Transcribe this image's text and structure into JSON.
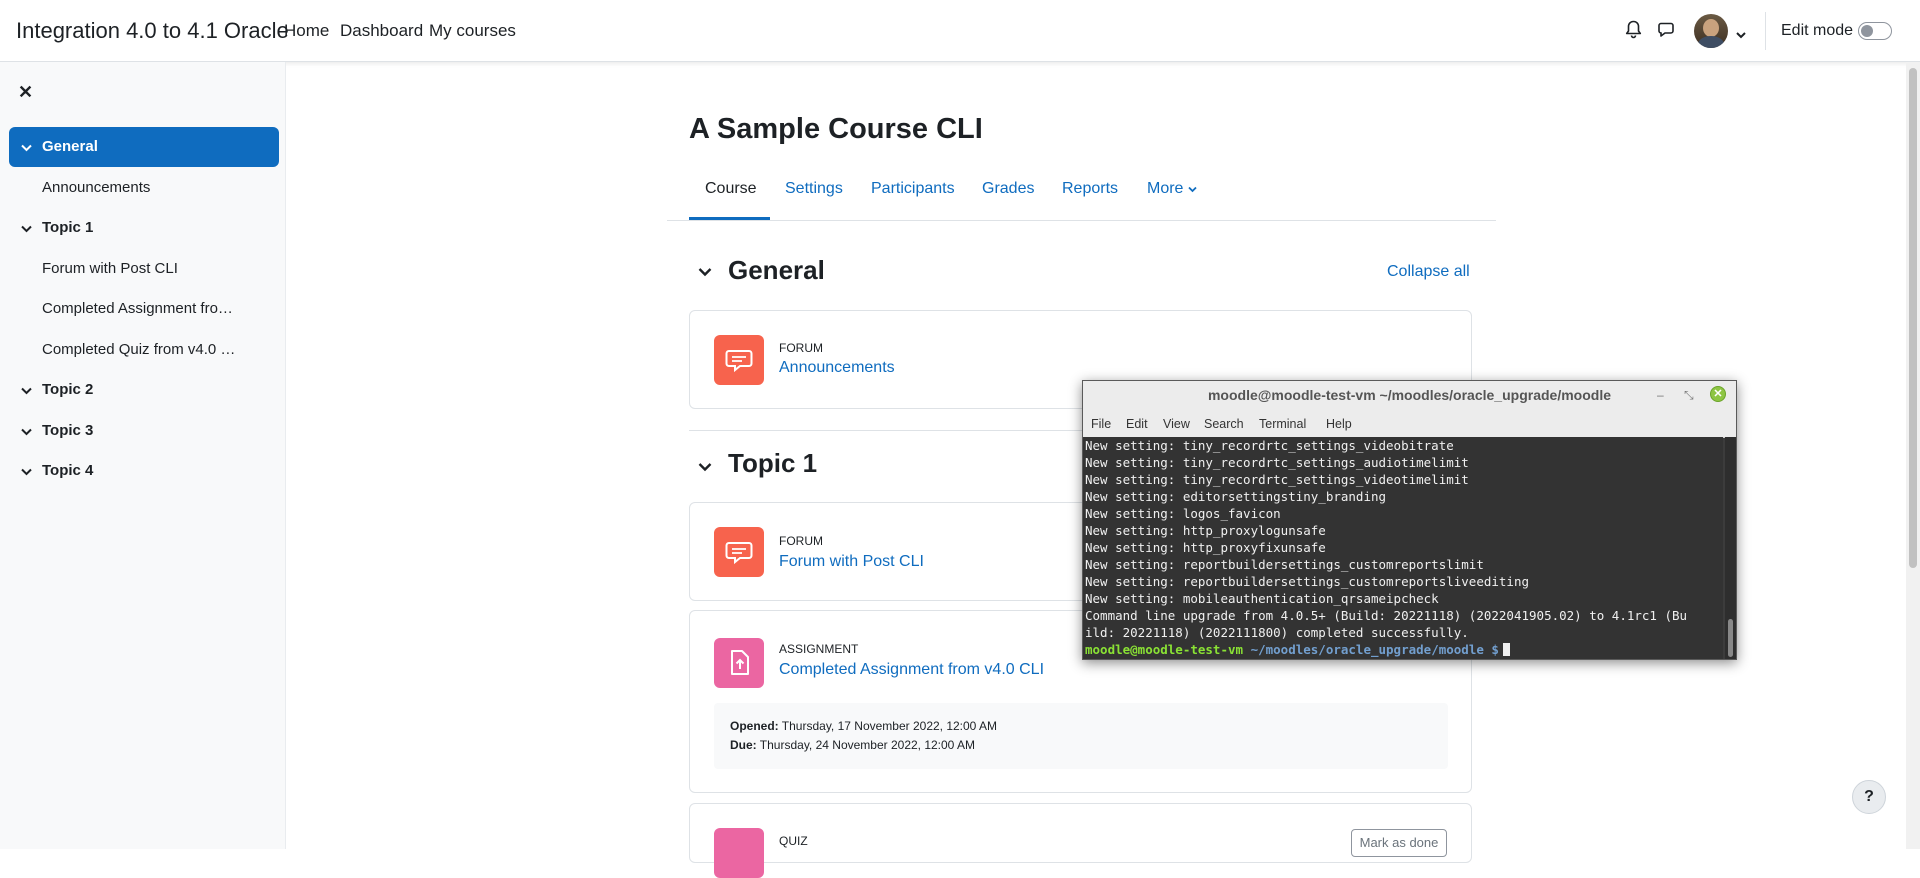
{
  "navbar": {
    "site_name": "Integration 4.0 to 4.1 Oracle",
    "links": [
      "Home",
      "Dashboard",
      "My courses"
    ],
    "edit_mode_label": "Edit mode"
  },
  "drawer": {
    "items": [
      {
        "label": "General",
        "type": "section",
        "active": true
      },
      {
        "label": "Announcements",
        "type": "child"
      },
      {
        "label": "Topic 1",
        "type": "section"
      },
      {
        "label": "Forum with Post CLI",
        "type": "child"
      },
      {
        "label": "Completed Assignment fro…",
        "type": "child"
      },
      {
        "label": "Completed Quiz from v4.0 …",
        "type": "child"
      },
      {
        "label": "Topic 2",
        "type": "section"
      },
      {
        "label": "Topic 3",
        "type": "section"
      },
      {
        "label": "Topic 4",
        "type": "section"
      }
    ]
  },
  "course": {
    "title": "A Sample Course CLI",
    "tabs": [
      "Course",
      "Settings",
      "Participants",
      "Grades",
      "Reports",
      "More"
    ],
    "collapse_all": "Collapse all",
    "sections": [
      {
        "title": "General"
      },
      {
        "title": "Topic 1"
      }
    ],
    "activities": [
      {
        "type": "FORUM",
        "name": "Announcements",
        "color": "#f7634d"
      },
      {
        "type": "FORUM",
        "name": "Forum with Post CLI",
        "color": "#f7634d"
      },
      {
        "type": "ASSIGNMENT",
        "name": "Completed Assignment from v4.0 CLI",
        "color": "#eb66a2",
        "opened_label": "Opened:",
        "opened": "Thursday, 17 November 2022, 12:00 AM",
        "due_label": "Due:",
        "due": "Thursday, 24 November 2022, 12:00 AM"
      },
      {
        "type": "QUIZ",
        "name": "",
        "color": "#eb66a2",
        "mark_done": "Mark as done"
      }
    ]
  },
  "help_button": "?",
  "terminal": {
    "title": "moodle@moodle-test-vm ~/moodles/oracle_upgrade/moodle",
    "menu": [
      "File",
      "Edit",
      "View",
      "Search",
      "Terminal",
      "Help"
    ],
    "lines": [
      "New setting: tiny_recordrtc_settings_videobitrate",
      "New setting: tiny_recordrtc_settings_audiotimelimit",
      "New setting: tiny_recordrtc_settings_videotimelimit",
      "New setting: editorsettingstiny_branding",
      "New setting: logos_favicon",
      "New setting: http_proxylogunsafe",
      "New setting: http_proxyfixunsafe",
      "New setting: reportbuildersettings_customreportslimit",
      "New setting: reportbuildersettings_customreportsliveediting",
      "New setting: mobileauthentication_qrsameipcheck",
      "Command line upgrade from 4.0.5+ (Build: 20221118) (2022041905.02) to 4.1rc1 (Bu",
      "ild: 20221118) (2022111800) completed successfully."
    ],
    "prompt_user": "moodle@moodle-test-vm",
    "prompt_path": " ~/moodles/oracle_upgrade/moodle $"
  }
}
